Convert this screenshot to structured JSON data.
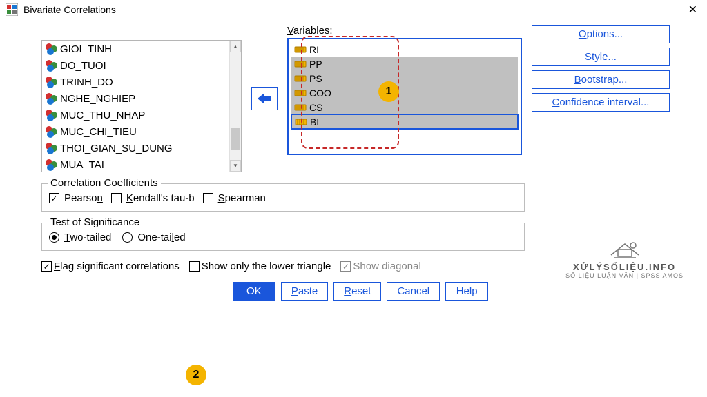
{
  "title": "Bivariate Correlations",
  "source_vars": [
    "GIOI_TINH",
    "DO_TUOI",
    "TRINH_DO",
    "NGHE_NGHIEP",
    "MUC_THU_NHAP",
    "MUC_CHI_TIEU",
    "THOI_GIAN_SU_DUNG",
    "MUA_TAI"
  ],
  "variables_label": "Variables:",
  "selected_vars": [
    "RI",
    "PP",
    "PS",
    "COO",
    "CS",
    "BL"
  ],
  "side_buttons": {
    "options": "Options...",
    "style": "Style...",
    "bootstrap": "Bootstrap...",
    "ci": "Confidence interval..."
  },
  "groups": {
    "coeff_title": "Correlation Coefficients",
    "pearson": "Pearson",
    "kendall": "Kendall's tau-b",
    "spearman": "Spearman",
    "sig_title": "Test of Significance",
    "two_tailed": "Two-tailed",
    "one_tailed": "One-tailed"
  },
  "flags": {
    "flag_sig": "Flag significant correlations",
    "lower_tri": "Show only the lower triangle",
    "diag": "Show diagonal"
  },
  "buttons": {
    "ok": "OK",
    "paste": "Paste",
    "reset": "Reset",
    "cancel": "Cancel",
    "help": "Help"
  },
  "callouts": {
    "one": "1",
    "two": "2"
  },
  "watermark": {
    "line1": "XỬLÝSỐLIỆU.INFO",
    "line2": "SỐ LIỆU LUẬN VĂN | SPSS AMOS"
  }
}
